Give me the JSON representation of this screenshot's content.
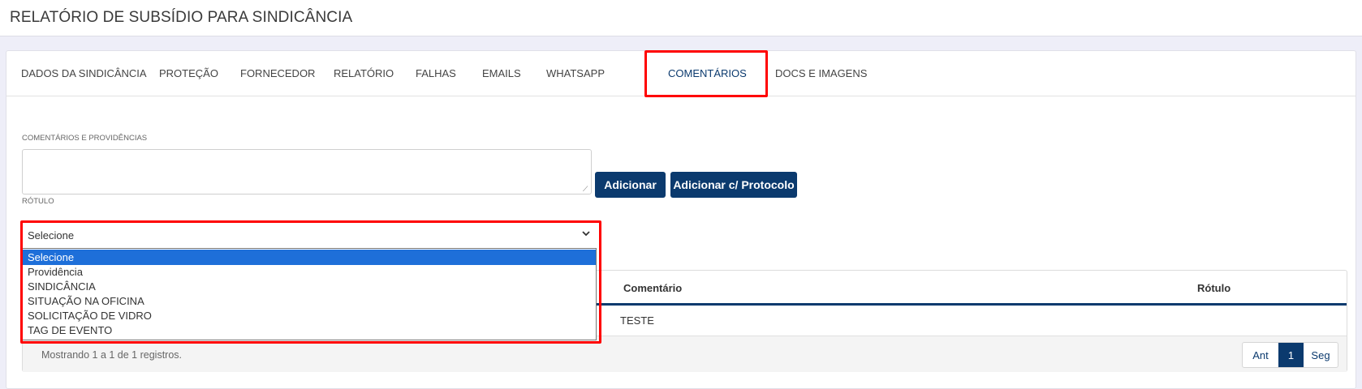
{
  "page": {
    "title": "RELATÓRIO DE SUBSÍDIO PARA SINDICÂNCIA"
  },
  "tabs": [
    {
      "label": "DADOS DA SINDICÂNCIA"
    },
    {
      "label": "PROTEÇÃO"
    },
    {
      "label": "FORNECEDOR"
    },
    {
      "label": "RELATÓRIO"
    },
    {
      "label": "FALHAS"
    },
    {
      "label": "EMAILS"
    },
    {
      "label": "WHATSAPP"
    },
    {
      "label": "COMENTÁRIOS",
      "active": true
    },
    {
      "label": "DOCS E IMAGENS"
    }
  ],
  "form": {
    "comments_label": "COMENTÁRIOS E PROVIDÊNCIAS",
    "comments_value": "",
    "add_label": "Adicionar",
    "add_protocol_label": "Adicionar c/ Protocolo",
    "rotulo_label": "RÓTULO",
    "rotulo_selected": "Selecione",
    "rotulo_options": [
      "Selecione",
      "Providência",
      "SINDICÂNCIA",
      "SITUAÇÃO NA OFICINA",
      "SOLICITAÇÃO DE VIDRO",
      "TAG DE EVENTO"
    ]
  },
  "table": {
    "columns": [
      "Comentário",
      "Rótulo"
    ],
    "rows": [
      {
        "comentario": "TESTE",
        "rotulo": ""
      }
    ],
    "footer_info": "Mostrando 1 a 1 de 1 registros.",
    "pagination": {
      "prev": "Ant",
      "current": "1",
      "next": "Seg"
    }
  },
  "colors": {
    "primary": "#0b3a6e",
    "highlight": "#ff0000",
    "option_selected": "#1e6fd9"
  },
  "icons": {
    "select_chevron": "chevron-down-icon"
  }
}
